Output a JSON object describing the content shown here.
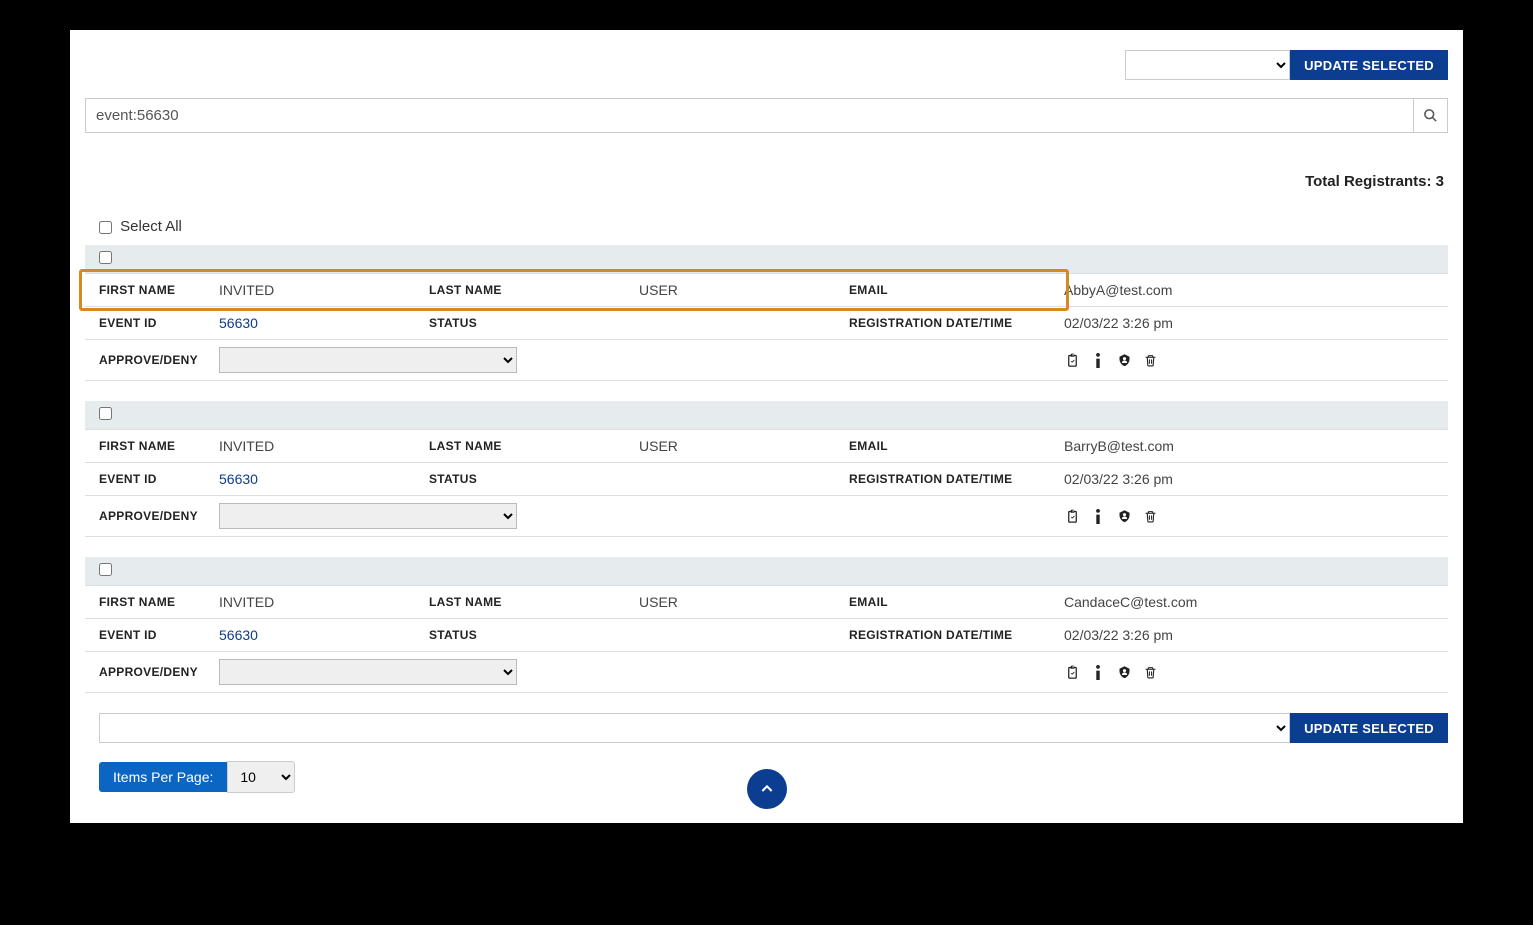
{
  "toolbar": {
    "updateSelected": "UPDATE SELECTED"
  },
  "search": {
    "value": "event:56630"
  },
  "summary": {
    "totalLabel": "Total Registrants: 3"
  },
  "selectAll": {
    "label": "Select All"
  },
  "labels": {
    "firstName": "FIRST NAME",
    "lastName": "LAST NAME",
    "email": "EMAIL",
    "eventId": "EVENT ID",
    "status": "STATUS",
    "regDateTime": "REGISTRATION DATE/TIME",
    "approveDeny": "APPROVE/DENY"
  },
  "registrants": [
    {
      "firstName": "INVITED",
      "lastName": "USER",
      "email": "AbbyA@test.com",
      "eventId": "56630",
      "status": "",
      "regDateTime": "02/03/22 3:26 pm",
      "highlighted": true
    },
    {
      "firstName": "INVITED",
      "lastName": "USER",
      "email": "BarryB@test.com",
      "eventId": "56630",
      "status": "",
      "regDateTime": "02/03/22 3:26 pm",
      "highlighted": false
    },
    {
      "firstName": "INVITED",
      "lastName": "USER",
      "email": "CandaceC@test.com",
      "eventId": "56630",
      "status": "",
      "regDateTime": "02/03/22 3:26 pm",
      "highlighted": false
    }
  ],
  "pagination": {
    "itemsPerPageLabel": "Items Per Page:",
    "itemsPerPageValue": "10"
  }
}
